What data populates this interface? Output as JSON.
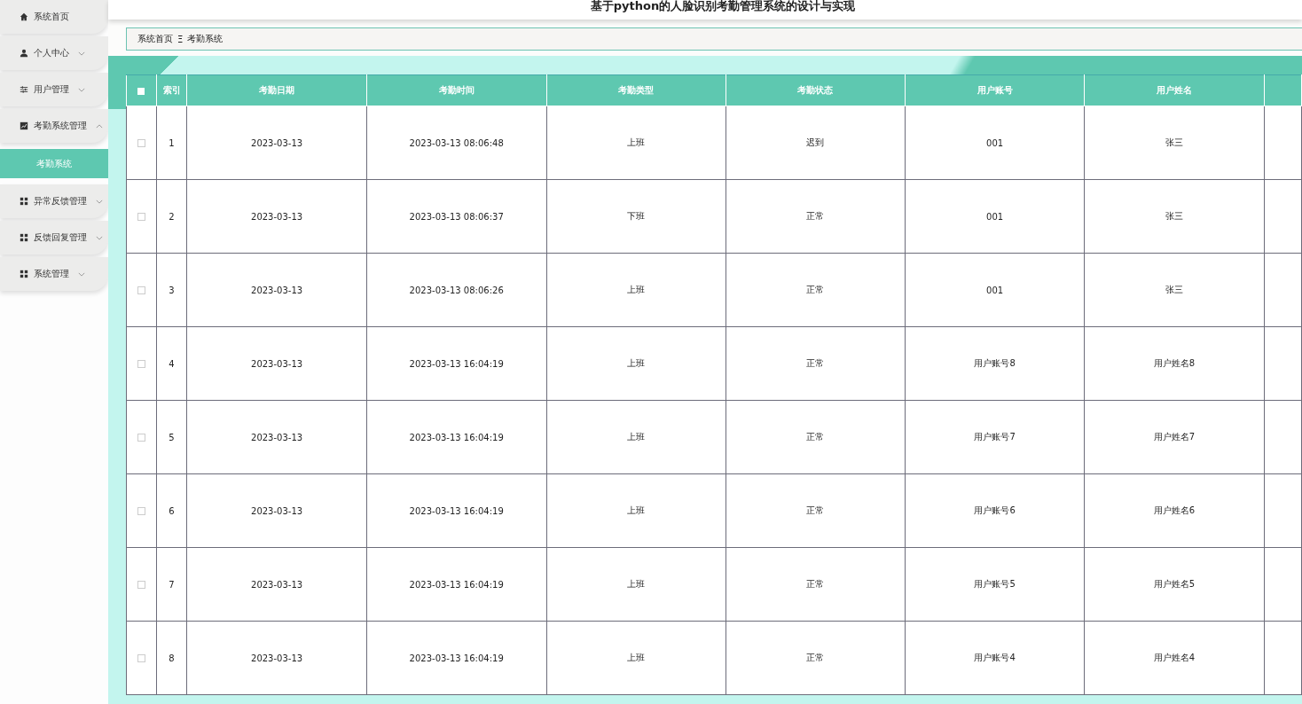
{
  "header": {
    "title": "基于python的人脸识别考勤管理系统的设计与实现"
  },
  "sidebar": {
    "items": [
      {
        "label": "系统首页",
        "kind": "link"
      },
      {
        "label": "个人中心",
        "kind": "menu",
        "expanded": false
      },
      {
        "label": "用户管理",
        "kind": "menu",
        "expanded": false
      },
      {
        "label": "考勤系统管理",
        "kind": "menu",
        "expanded": true,
        "children": [
          {
            "label": "考勤系统",
            "selected": true
          }
        ]
      },
      {
        "label": "异常反馈管理",
        "kind": "menu",
        "expanded": false
      },
      {
        "label": "反馈回复管理",
        "kind": "menu",
        "expanded": false
      },
      {
        "label": "系统管理",
        "kind": "menu",
        "expanded": false
      }
    ]
  },
  "breadcrumb": {
    "items": [
      "系统首页",
      "考勤系统"
    ],
    "separator": "Ξ"
  },
  "table": {
    "select_all_checked": false,
    "columns": [
      "索引",
      "考勤日期",
      "考勤时间",
      "考勤类型",
      "考勤状态",
      "用户账号",
      "用户姓名"
    ],
    "rows": [
      {
        "checked": false,
        "cells": [
          "1",
          "2023-03-13",
          "2023-03-13 08:06:48",
          "上班",
          "迟到",
          "001",
          "张三"
        ]
      },
      {
        "checked": false,
        "cells": [
          "2",
          "2023-03-13",
          "2023-03-13 08:06:37",
          "下班",
          "正常",
          "001",
          "张三"
        ]
      },
      {
        "checked": false,
        "cells": [
          "3",
          "2023-03-13",
          "2023-03-13 08:06:26",
          "上班",
          "正常",
          "001",
          "张三"
        ]
      },
      {
        "checked": false,
        "cells": [
          "4",
          "2023-03-13",
          "2023-03-13 16:04:19",
          "上班",
          "正常",
          "用户账号8",
          "用户姓名8"
        ]
      },
      {
        "checked": false,
        "cells": [
          "5",
          "2023-03-13",
          "2023-03-13 16:04:19",
          "上班",
          "正常",
          "用户账号7",
          "用户姓名7"
        ]
      },
      {
        "checked": false,
        "cells": [
          "6",
          "2023-03-13",
          "2023-03-13 16:04:19",
          "上班",
          "正常",
          "用户账号6",
          "用户姓名6"
        ]
      },
      {
        "checked": false,
        "cells": [
          "7",
          "2023-03-13",
          "2023-03-13 16:04:19",
          "上班",
          "正常",
          "用户账号5",
          "用户姓名5"
        ]
      },
      {
        "checked": false,
        "cells": [
          "8",
          "2023-03-13",
          "2023-03-13 16:04:19",
          "上班",
          "正常",
          "用户账号4",
          "用户姓名4"
        ]
      }
    ]
  }
}
